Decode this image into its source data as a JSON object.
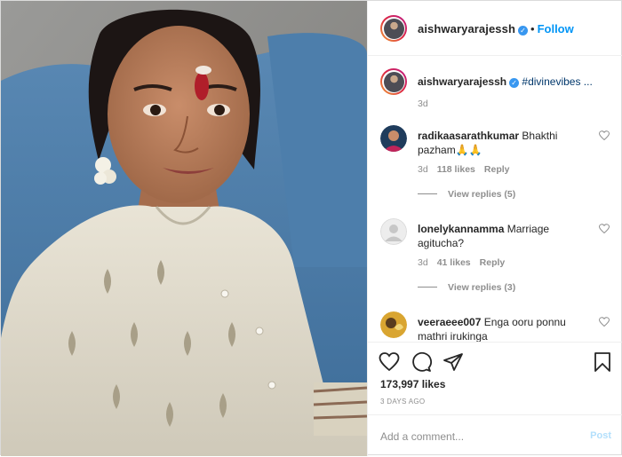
{
  "post": {
    "author": "aishwaryarajessh",
    "follow_separator": "•",
    "follow_label": "Follow",
    "caption": {
      "username": "aishwaryarajessh",
      "text": "#divinevibes ...",
      "age": "3d"
    },
    "comments": [
      {
        "username": "radikaasarathkumar",
        "text": "Bhakthi pazham🙏🙏",
        "age": "3d",
        "likes": "118 likes",
        "reply_label": "Reply",
        "view_replies": "View replies (5)"
      },
      {
        "username": "lonelykannamma",
        "text": "Marriage agitucha?",
        "age": "3d",
        "likes": "41 likes",
        "reply_label": "Reply",
        "view_replies": "View replies (3)"
      },
      {
        "username": "veeraeee007",
        "text": "Enga ooru ponnu mathri irukinga"
      }
    ],
    "likes_count": "173,997 likes",
    "time_ago": "3 DAYS AGO",
    "comment_placeholder": "Add a comment...",
    "post_button": "Post"
  },
  "colors": {
    "link": "#0095f6",
    "verified": "#3897f0",
    "muted": "#8e8e8e",
    "post_disabled": "#b2dffc"
  },
  "icons": {
    "verified": "verified-badge-icon",
    "like": "heart-icon",
    "comment": "comment-bubble-icon",
    "share": "paper-plane-icon",
    "save": "bookmark-icon"
  }
}
